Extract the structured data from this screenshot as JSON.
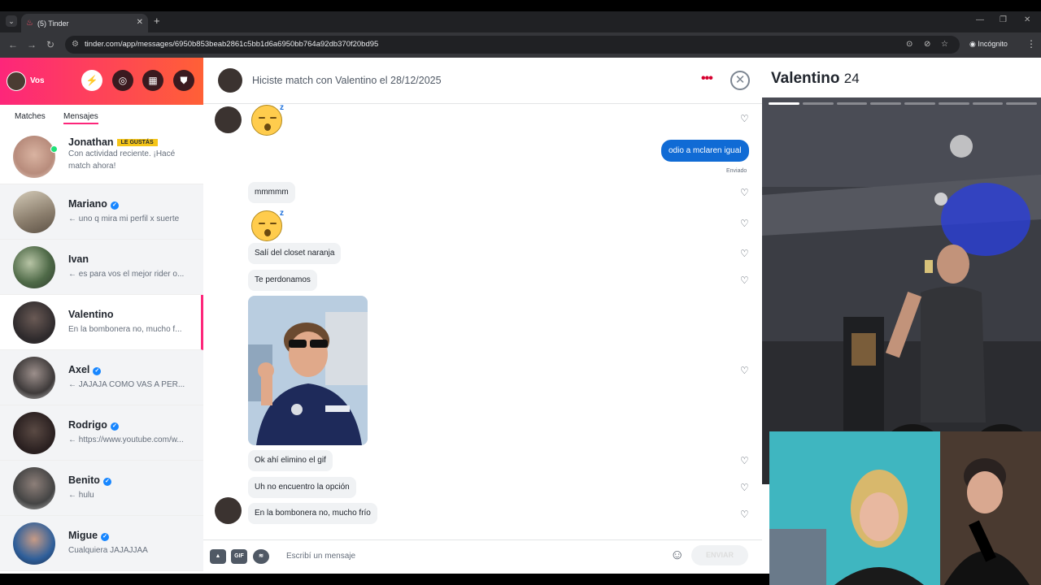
{
  "browser": {
    "tab_title": "(5) Tinder",
    "url": "tinder.com/app/messages/6950b853beab2861c5bb1d6a6950bb764a92db370f20bd95",
    "incognito_label": "Incógnito"
  },
  "sidebar": {
    "me_label": "Vos",
    "tabs": [
      "Matches",
      "Mensajes"
    ],
    "active_tab": "Mensajes",
    "conversations": [
      {
        "name": "Jonathan",
        "badge": "LE GUSTÁS",
        "message": "Con actividad reciente. ¡Hacé match ahora!",
        "verified": false
      },
      {
        "name": "Mariano",
        "message": "← uno q mira mi perfil x suerte",
        "verified": true
      },
      {
        "name": "Ivan",
        "message": "← es para vos el mejor rider o...",
        "verified": false
      },
      {
        "name": "Valentino",
        "message": "En la bombonera no, mucho f...",
        "verified": false,
        "selected": true
      },
      {
        "name": "Axel",
        "message": "← JAJAJA COMO VAS A PER...",
        "verified": true
      },
      {
        "name": "Rodrigo",
        "message": "← https://www.youtube.com/w...",
        "verified": true
      },
      {
        "name": "Benito",
        "message": "← hulu",
        "verified": true
      },
      {
        "name": "Migue",
        "message": "Cualquiera JAJAJJAA",
        "verified": true
      }
    ]
  },
  "chat": {
    "header_title": "Hiciste match con Valentino el 28/12/2025",
    "messages": {
      "out1": "odio a mclaren igual",
      "sent_label": "Enviado",
      "in1": "mmmmm",
      "in2": "Salí del closet naranja",
      "in3": "Te perdonamos",
      "in4": "Ok ahí elimino el gif",
      "in5": "Uh no encuentro la opción",
      "in6": "En la bombonera no, mucho frío"
    },
    "composer": {
      "placeholder": "Escribí un mensaje",
      "send_label": "ENVIAR",
      "gif_label": "GIF"
    }
  },
  "profile": {
    "name": "Valentino",
    "age": "24",
    "photo_count": 8,
    "active_photo": 1
  },
  "colors": {
    "brand_gradient_start": "#fd267a",
    "brand_gradient_end": "#ff6036",
    "outgoing_bubble": "#106bd5",
    "verified": "#1786ff"
  }
}
